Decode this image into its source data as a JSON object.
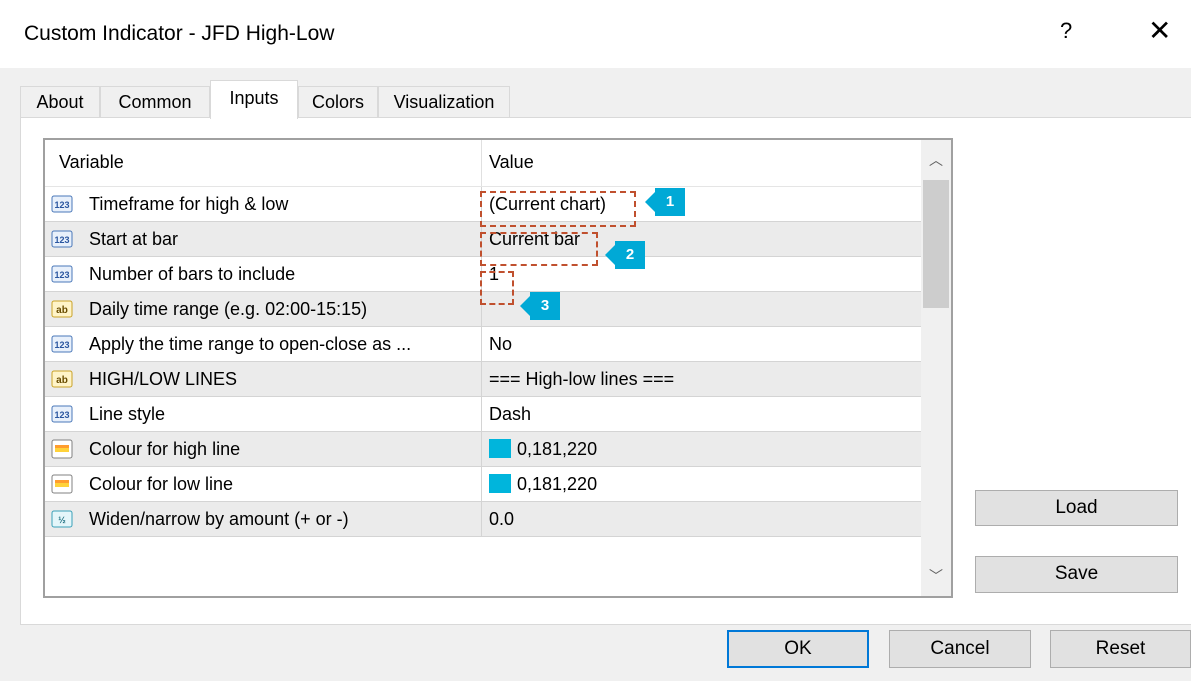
{
  "window": {
    "title": "Custom Indicator - JFD High-Low",
    "help_label": "?",
    "close_label": "✕"
  },
  "tabs": [
    {
      "label": "About"
    },
    {
      "label": "Common"
    },
    {
      "label": "Inputs"
    },
    {
      "label": "Colors"
    },
    {
      "label": "Visualization"
    }
  ],
  "active_tab": "Inputs",
  "table": {
    "col_variable": "Variable",
    "col_value": "Value",
    "rows": [
      {
        "icon": "numeric-icon",
        "variable": "Timeframe for high & low",
        "value": "(Current chart)"
      },
      {
        "icon": "numeric-icon",
        "variable": "Start at bar",
        "value": "Current bar"
      },
      {
        "icon": "numeric-icon",
        "variable": "Number of bars to include",
        "value": "1"
      },
      {
        "icon": "text-icon",
        "variable": "Daily time range (e.g. 02:00-15:15)",
        "value": ""
      },
      {
        "icon": "numeric-icon",
        "variable": "Apply the time range to open-close as ...",
        "value": "No"
      },
      {
        "icon": "text-icon",
        "variable": "HIGH/LOW LINES",
        "value": "=== High-low lines ==="
      },
      {
        "icon": "numeric-icon",
        "variable": "Line style",
        "value": "Dash"
      },
      {
        "icon": "color-icon",
        "variable": "Colour for high line",
        "value": "0,181,220",
        "swatch": "#00b5dc"
      },
      {
        "icon": "color-icon",
        "variable": "Colour for low line",
        "value": "0,181,220",
        "swatch": "#00b5dc"
      },
      {
        "icon": "fraction-icon",
        "variable": "Widen/narrow by amount (+ or -)",
        "value": "0.0"
      }
    ]
  },
  "buttons": {
    "load": "Load",
    "save": "Save",
    "ok": "OK",
    "cancel": "Cancel",
    "reset": "Reset"
  },
  "callouts": [
    {
      "number": "1"
    },
    {
      "number": "2"
    },
    {
      "number": "3"
    }
  ],
  "colors": {
    "accent": "#00a9d6",
    "highlight_border": "#c0502e",
    "swatch": "#00b5dc"
  }
}
